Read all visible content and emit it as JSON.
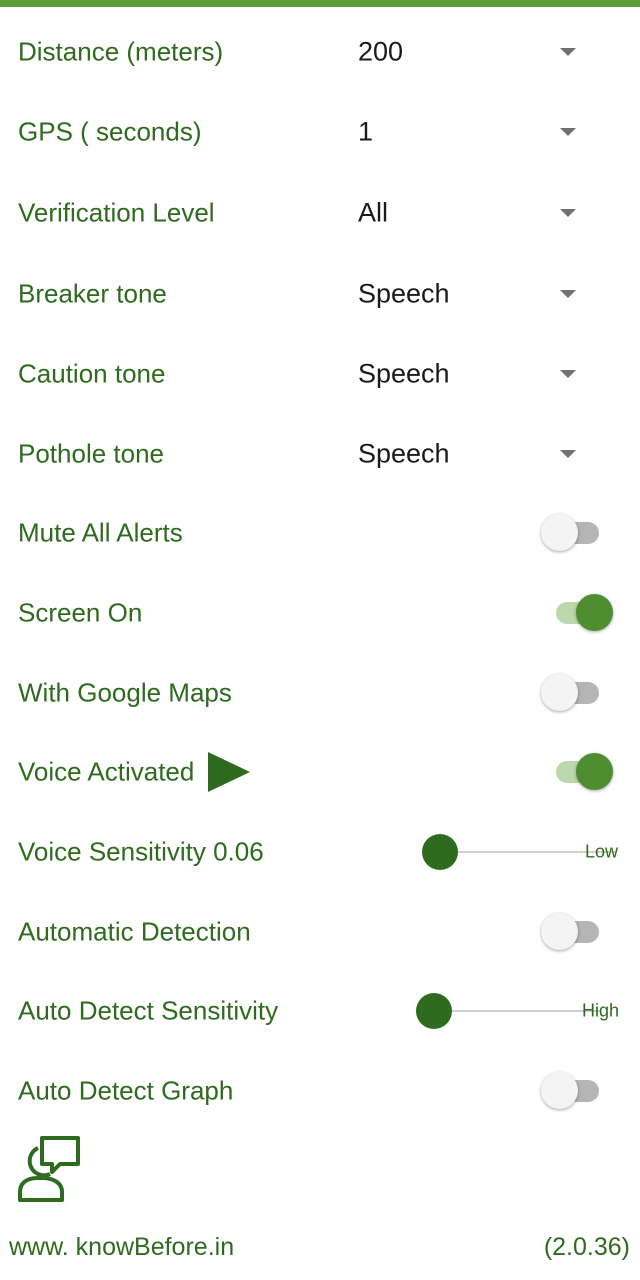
{
  "colors": {
    "accent": "#2e6b1e",
    "switch_on": "#4e8e30",
    "top_bar": "#5a9a3a"
  },
  "settings": {
    "distance": {
      "label": "Distance (meters)",
      "value": "200"
    },
    "gps": {
      "label": "GPS ( seconds)",
      "value": "1"
    },
    "verification": {
      "label": "Verification Level",
      "value": "All"
    },
    "breaker_tone": {
      "label": "Breaker tone",
      "value": "Speech"
    },
    "caution_tone": {
      "label": "Caution tone",
      "value": "Speech"
    },
    "pothole_tone": {
      "label": "Pothole tone",
      "value": "Speech"
    },
    "mute_all": {
      "label": "Mute All Alerts",
      "on": false
    },
    "screen_on": {
      "label": "Screen On",
      "on": true
    },
    "google_maps": {
      "label": "With Google Maps",
      "on": false
    },
    "voice_activated": {
      "label": "Voice Activated",
      "on": true,
      "icon": "play-icon"
    },
    "voice_sensitivity": {
      "label": "Voice Sensitivity 0.06",
      "end_label": "Low",
      "level": 0.06
    },
    "automatic_detection": {
      "label": "Automatic  Detection",
      "on": false
    },
    "auto_detect_sensitivity": {
      "label": "Auto Detect Sensitivity",
      "end_label": "High",
      "level": 0.0
    },
    "auto_detect_graph": {
      "label": "Auto Detect Graph",
      "on": false
    }
  },
  "feedback": {
    "icon": "feedback-icon"
  },
  "footer": {
    "website": "www. knowBefore.in",
    "version": "(2.0.36)"
  }
}
